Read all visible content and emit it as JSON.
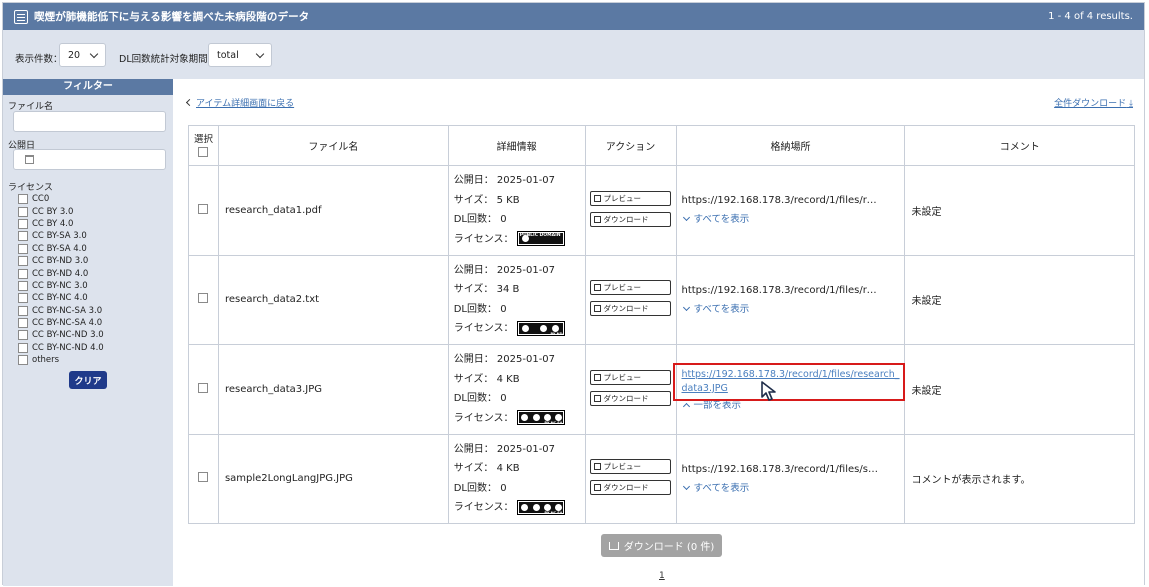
{
  "header": {
    "title": "喫煙が肺機能低下に与える影響を調べた未病段階のデータ",
    "results": "1 - 4 of 4 results."
  },
  "options": {
    "per_page_label": "表示件数：",
    "per_page_value": "20",
    "period_label": "DL回数統計対象期間：",
    "period_value": "total"
  },
  "filter": {
    "heading": "フィルター",
    "filename_label": "ファイル名",
    "date_label": "公開日",
    "license_label": "ライセンス",
    "licenses": [
      "CC0",
      "CC BY 3.0",
      "CC BY 4.0",
      "CC BY-SA 3.0",
      "CC BY-SA 4.0",
      "CC BY-ND 3.0",
      "CC BY-ND 4.0",
      "CC BY-NC 3.0",
      "CC BY-NC 4.0",
      "CC BY-NC-SA 3.0",
      "CC BY-NC-SA 4.0",
      "CC BY-NC-ND 3.0",
      "CC BY-NC-ND 4.0",
      "others"
    ],
    "clear_label": "クリア"
  },
  "main": {
    "back_link": "アイテム詳細画面に戻る",
    "download_all": "全件ダウンロード",
    "columns": {
      "select": "選択",
      "filename": "ファイル名",
      "details": "詳細情報",
      "action": "アクション",
      "location": "格納場所",
      "comment": "コメント"
    },
    "labels": {
      "published": "公開日：",
      "size": "サイズ：",
      "dl_count": "DL回数：",
      "license": "ライセンス：",
      "preview": "プレビュー",
      "download": "ダウンロード",
      "show_all": "すべてを表示",
      "show_part": "一部を表示"
    },
    "rows": [
      {
        "filename": "research_data1.pdf",
        "published": "2025-01-07",
        "size": "5 KB",
        "dl": "0",
        "license_text": "PUBLIC DOMAIN",
        "location": "https://192.168.178.3/record/1/files/rese…",
        "comment": "未設定"
      },
      {
        "filename": "research_data2.txt",
        "published": "2025-01-07",
        "size": "34 B",
        "dl": "0",
        "license_text": "BY ND",
        "location": "https://192.168.178.3/record/1/files/rese…",
        "comment": "未設定"
      },
      {
        "filename": "research_data3.JPG",
        "published": "2025-01-07",
        "size": "4 KB",
        "dl": "0",
        "license_text": "BY NC SA",
        "location": "https://192.168.178.3/record/1/files/research_data3.JPG",
        "comment": "未設定"
      },
      {
        "filename": "sample2LongLangJPG.JPG",
        "published": "2025-01-07",
        "size": "4 KB",
        "dl": "0",
        "license_text": "BY NC SA",
        "location": "https://192.168.178.3/record/1/files/sam…",
        "comment": "コメントが表示されます。"
      }
    ],
    "download_button": "ダウンロード (0 件)",
    "page_number": "1"
  }
}
